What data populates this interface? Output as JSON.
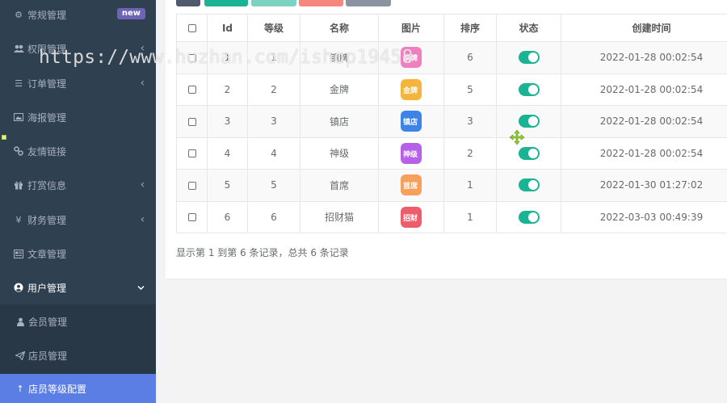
{
  "sidebar": {
    "items": [
      {
        "label": "常规管理",
        "icon": "cogs-icon",
        "glyph": "⚙",
        "badge": "new"
      },
      {
        "label": "权限管理",
        "icon": "users-icon",
        "glyph": "👥",
        "arrow": "‹"
      },
      {
        "label": "订单管理",
        "icon": "list-icon",
        "glyph": "☰",
        "arrow": "‹"
      },
      {
        "label": "海报管理",
        "icon": "image-icon",
        "glyph": "▣"
      },
      {
        "label": "友情链接",
        "icon": "link-icon",
        "glyph": "🔗"
      },
      {
        "label": "打赏信息",
        "icon": "gift-icon",
        "glyph": "🎁",
        "arrow": "‹"
      },
      {
        "label": "财务管理",
        "icon": "yen-icon",
        "glyph": "¥",
        "arrow": "‹"
      },
      {
        "label": "文章管理",
        "icon": "newspaper-icon",
        "glyph": "▤"
      },
      {
        "label": "用户管理",
        "icon": "user-circle-icon",
        "glyph": "◉",
        "arrow": "⌄"
      }
    ],
    "sub_items": [
      {
        "label": "会员管理",
        "icon": "user-icon",
        "glyph": "●"
      },
      {
        "label": "店员管理",
        "icon": "paper-plane-icon",
        "glyph": "➤"
      },
      {
        "label": "店员等级配置",
        "icon": "arrow-up-icon",
        "glyph": "↑"
      }
    ]
  },
  "table": {
    "headers": [
      "Id",
      "等级",
      "名称",
      "图片",
      "排序",
      "状态",
      "创建时间"
    ],
    "rows": [
      {
        "id": "1",
        "level": "1",
        "name": "铜牌",
        "thumb_text": "铜牌",
        "thumb_color": "#f27ec2",
        "sort": "6",
        "created": "2022-01-28 00:02:54"
      },
      {
        "id": "2",
        "level": "2",
        "name": "金牌",
        "thumb_text": "金牌",
        "thumb_color": "#f5b43b",
        "sort": "5",
        "created": "2022-01-28 00:02:54"
      },
      {
        "id": "3",
        "level": "3",
        "name": "镇店",
        "thumb_text": "镇店",
        "thumb_color": "#3d84e8",
        "sort": "3",
        "created": "2022-01-28 00:02:54"
      },
      {
        "id": "4",
        "level": "4",
        "name": "神级",
        "thumb_text": "神级",
        "thumb_color": "#b761e8",
        "sort": "2",
        "created": "2022-01-28 00:02:54"
      },
      {
        "id": "5",
        "level": "5",
        "name": "首席",
        "thumb_text": "首席",
        "thumb_color": "#f7a05b",
        "sort": "1",
        "created": "2022-01-30 01:27:02"
      },
      {
        "id": "6",
        "level": "6",
        "name": "招财猫",
        "thumb_text": "招财",
        "thumb_color": "#ee5d6b",
        "sort": "1",
        "created": "2022-03-03 00:49:39"
      }
    ]
  },
  "pager": {
    "summary": "显示第 1 到第 6 条记录，总共 6 条记录"
  },
  "toolbar_colors": [
    "#505a6e",
    "#1ab394",
    "#7bd3c1",
    "#f6877e",
    "#8b93a3"
  ],
  "watermark": "https://www.huzhan.com/ishop19458"
}
